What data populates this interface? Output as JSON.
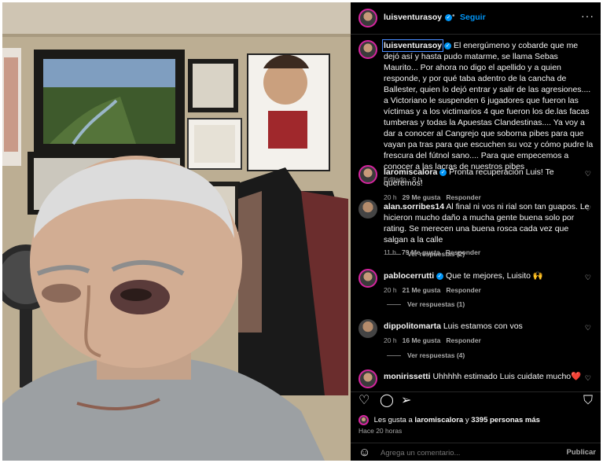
{
  "header": {
    "username": "luisventurasoy",
    "follow_label": "Seguir",
    "more_icon": "more-horizontal-icon"
  },
  "caption": {
    "username": "luisventurasoy",
    "text": "El energúmeno y cobarde que me dejó así y hasta pudo matarme, se llama Sebas Maurito... Por ahora no digo el apellido y a quien responde, y por qué taba adentro de la cancha de Ballester, quien lo dejó entrar y salir de las agresiones.... a Victoriano le suspenden 6 jugadores que fueron las víctimas y a los victimarios 4 que fueron los de.las facas tumberas y todas la Apuestas Clandestinas.... Ya voy a dar a conocer al Cangrejo que soborna pibes para que vayan pa tras para que escuchen su voz y cómo pudre la frescura del fútnol sano.... Para que empecemos a conocer a las lacras de nuestros pibes",
    "meta": "Editado · 9 h"
  },
  "comments": [
    {
      "username": "laromiscalora",
      "verified": true,
      "text": "Pronta recuperación Luis! Te queremos!",
      "time": "20 h",
      "likes": "29 Me gusta",
      "reply": "Responder"
    },
    {
      "username": "alan.sorribes14",
      "verified": false,
      "text": "Al final ni vos ni rial son tan guapos. Le hicieron mucho daño a mucha gente buena solo por rating. Se merecen una buena rosca cada vez que salgan a la calle",
      "time": "11 h",
      "likes": "79 Me gusta",
      "reply": "Responder",
      "view_replies": "Ver respuestas (2)"
    },
    {
      "username": "pablocerrutti",
      "verified": true,
      "text": "Que te mejores, Luisito 🙌",
      "time": "20 h",
      "likes": "21 Me gusta",
      "reply": "Responder",
      "view_replies": "Ver respuestas (1)"
    },
    {
      "username": "dippolitomarta",
      "verified": false,
      "text": "Luis estamos con vos",
      "time": "20 h",
      "likes": "16 Me gusta",
      "reply": "Responder",
      "view_replies": "Ver respuestas (4)"
    },
    {
      "username": "monirissetti",
      "verified": false,
      "text": "Uhhhhh estimado Luis cuidate mucho❤️",
      "time": "",
      "likes": "",
      "reply": ""
    }
  ],
  "likes_summary": {
    "prefix": "Les gusta a",
    "user": "laromiscalora",
    "middle": "y",
    "count": "3395 personas más"
  },
  "post_time": "Hace 20 horas",
  "composer": {
    "placeholder": "Agrega un comentario...",
    "publish_label": "Publicar"
  },
  "colors": {
    "accent": "#0095f6",
    "panel_bg": "#000000",
    "text": "#f5f5f5",
    "muted": "#a8a8a8"
  }
}
